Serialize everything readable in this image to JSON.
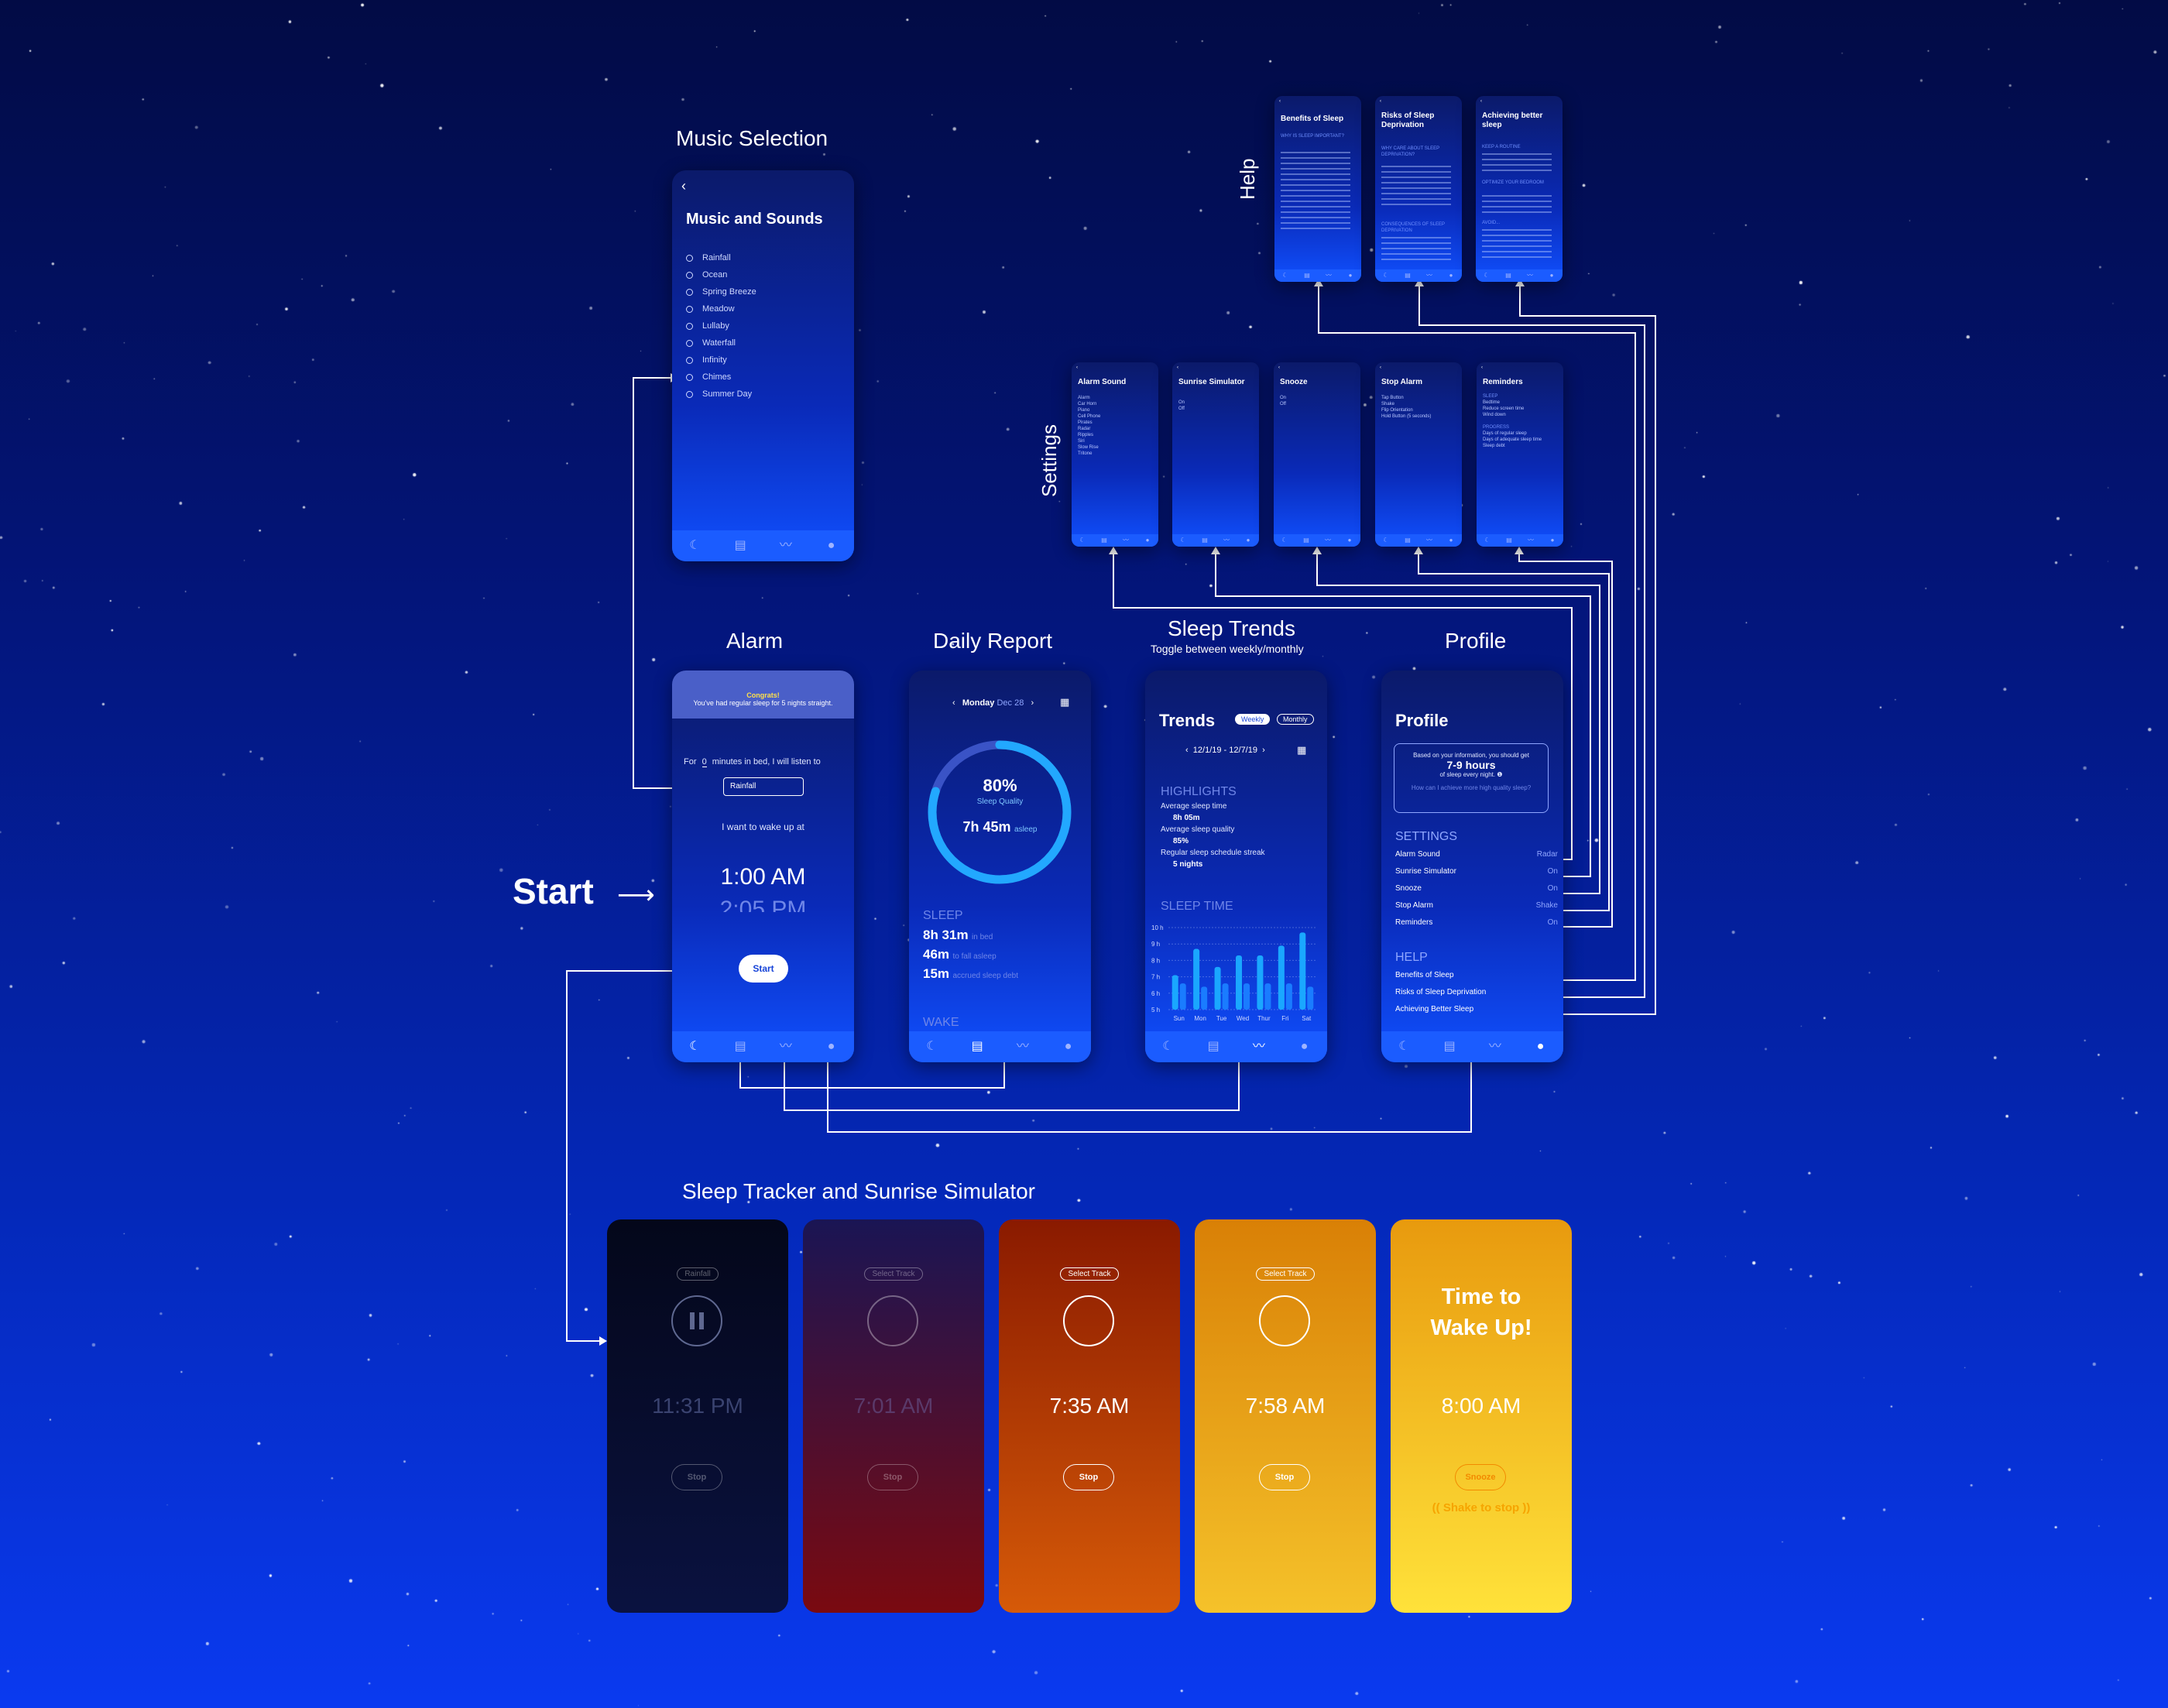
{
  "sections": {
    "music": "Music Selection",
    "help": "Help",
    "settings": "Settings",
    "alarm": "Alarm",
    "daily": "Daily Report",
    "trends": "Sleep Trends",
    "trends_sub": "Toggle between weekly/monthly",
    "profile": "Profile",
    "start": "Start",
    "tracker": "Sleep Tracker and Sunrise Simulator"
  },
  "music": {
    "title": "Music and Sounds",
    "items": [
      "Rainfall",
      "Ocean",
      "Spring Breeze",
      "Meadow",
      "Lullaby",
      "Waterfall",
      "Infinity",
      "Chimes",
      "Summer Day"
    ]
  },
  "help_screens": [
    {
      "title": "Benefits of Sleep",
      "h1": "WHY IS SLEEP IMPORTANT?",
      "h2": ""
    },
    {
      "title": "Risks of Sleep Deprivation",
      "h1": "WHY CARE ABOUT SLEEP DEPRIVATION?",
      "h2": "CONSEQUENCES OF SLEEP DEPRIVATION"
    },
    {
      "title": "Achieving better sleep",
      "h1": "KEEP A ROUTINE",
      "h2": "OPTIMIZE YOUR BEDROOM",
      "h3": "AVOID..."
    }
  ],
  "settings_screens": [
    {
      "title": "Alarm Sound",
      "items": [
        "Alarm",
        "Car Horn",
        "Piano",
        "Cell Phone",
        "Pirates",
        "Radar",
        "Ripples",
        "Siri",
        "Slow Rise",
        "Tritone"
      ]
    },
    {
      "title": "Sunrise Simulator",
      "items": [
        "On",
        "Off"
      ]
    },
    {
      "title": "Snooze",
      "items": [
        "On",
        "Off"
      ]
    },
    {
      "title": "Stop Alarm",
      "items": [
        "Tap Button",
        "Shake",
        "Flip Orientation",
        "Hold Button (5 seconds)"
      ]
    },
    {
      "title": "Reminders",
      "items": [
        "SLEEP",
        "Bedtime",
        "Reduce screen time",
        "Wind down",
        "PROGRESS",
        "Days of regular sleep",
        "Days of adequate sleep time",
        "Sleep debt"
      ]
    }
  ],
  "alarm": {
    "banner_title": "Congrats!",
    "banner_text": "You've had regular sleep for 5 nights straight.",
    "for_label": "For",
    "minutes": "0",
    "bed_text": "minutes in bed, I will listen to",
    "track": "Rainfall",
    "wake_label": "I want to wake up at",
    "time": "1:00 AM",
    "time_next": "2:05 PM",
    "start_btn": "Start"
  },
  "daily": {
    "date_day": "Monday",
    "date": "Dec 28",
    "quality_pct": "80%",
    "quality_label": "Sleep Quality",
    "asleep": "7h 45m",
    "asleep_label": "asleep",
    "quality_value": 0.8,
    "sleep_header": "SLEEP",
    "in_bed": "8h 31m",
    "in_bed_label": "in bed",
    "fall": "46m",
    "fall_label": "to fall asleep",
    "debt": "15m",
    "debt_label": "accrued sleep debt",
    "wake_header": "WAKE"
  },
  "trends": {
    "title": "Trends",
    "weekly": "Weekly",
    "monthly": "Monthly",
    "range": "12/1/19 - 12/7/19",
    "highlights": "HIGHLIGHTS",
    "avg_time_label": "Average sleep time",
    "avg_time": "8h 05m",
    "avg_quality_label": "Average sleep quality",
    "avg_quality": "85%",
    "streak_label": "Regular sleep schedule streak",
    "streak": "5 nights",
    "sleep_time": "SLEEP TIME"
  },
  "chart_data": {
    "type": "bar",
    "categories": [
      "Sun",
      "Mon",
      "Tue",
      "Wed",
      "Thur",
      "Fri",
      "Sat"
    ],
    "series": [
      {
        "values": [
          7.1,
          8.7,
          7.6,
          8.3,
          8.3,
          8.9,
          9.7
        ]
      },
      {
        "values": [
          6.6,
          6.4,
          6.6,
          6.6,
          6.6,
          6.6,
          6.4
        ]
      }
    ],
    "yticks": [
      "10 h",
      "9 h",
      "8 h",
      "7 h",
      "6 h",
      "5 h"
    ],
    "ylim": [
      5,
      10
    ],
    "title": "SLEEP TIME"
  },
  "profile": {
    "title": "Profile",
    "info_pre": "Based on your information, you should get",
    "hours": "7-9 hours",
    "info_post": "of sleep every night.",
    "link": "How can I achieve more high quality sleep?",
    "settings_header": "SETTINGS",
    "settings": [
      {
        "label": "Alarm Sound",
        "value": "Radar"
      },
      {
        "label": "Sunrise Simulator",
        "value": "On"
      },
      {
        "label": "Snooze",
        "value": "On"
      },
      {
        "label": "Stop Alarm",
        "value": "Shake"
      },
      {
        "label": "Reminders",
        "value": "On"
      }
    ],
    "help_header": "HELP",
    "help": [
      "Benefits of Sleep",
      "Risks of Sleep Deprivation",
      "Achieving Better Sleep"
    ]
  },
  "trackers": [
    {
      "track": "Rainfall",
      "time": "11:31 PM",
      "btn": "Stop",
      "bg": "#03081f"
    },
    {
      "track": "Select Track",
      "time": "7:01 AM",
      "btn": "Stop",
      "bg": "#4a0a28"
    },
    {
      "track": "Select Track",
      "time": "7:35 AM",
      "btn": "Stop",
      "bg": "#c23b00"
    },
    {
      "track": "Select Track",
      "time": "7:58 AM",
      "btn": "Stop",
      "bg": "#f0a000"
    },
    {
      "wake1": "Time to",
      "wake2": "Wake Up!",
      "time": "8:00 AM",
      "btn": "Snooze",
      "shake": "Shake to stop",
      "bg": "#ffd21c"
    }
  ]
}
